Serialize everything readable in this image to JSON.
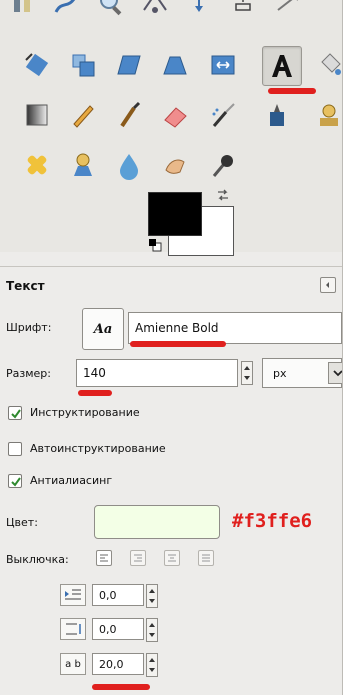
{
  "tool_options": {
    "title": "Текст",
    "font": {
      "label": "Шрифт:",
      "preview": "Aa",
      "value": "Amienne Bold"
    },
    "size": {
      "label": "Размер:",
      "value": "140",
      "unit": "px"
    },
    "hinting": {
      "label": "Инструктирование",
      "checked": true
    },
    "autohint": {
      "label": "Автоинструктирование",
      "checked": false
    },
    "antialias": {
      "label": "Антиалиасинг",
      "checked": true
    },
    "color": {
      "label": "Цвет:",
      "value": "#f3ffe6",
      "annotation": "#f3ffe6"
    },
    "justify": {
      "label": "Выключка:",
      "active_index": 0
    },
    "indent": {
      "value": "0,0"
    },
    "line_spacing": {
      "value": "0,0"
    },
    "letter_spacing": {
      "value": "20,0",
      "icon_text": "a b"
    }
  },
  "colors": {
    "foreground": "#000000",
    "background": "#ffffff",
    "annotation": "#e0201e"
  },
  "toolbox": {
    "active_tool": "text-tool",
    "icons": [
      "smudge-icon",
      "path-icon",
      "zoom-icon",
      "measure-icon",
      "move-icon",
      "align-icon",
      "crop-icon",
      "rotate-icon",
      "scale-icon",
      "shear-icon",
      "perspective-icon",
      "flip-icon",
      "text-icon",
      "bucket-fill-icon",
      "blend-icon",
      "pencil-icon",
      "paintbrush-icon",
      "eraser-icon",
      "airbrush-icon",
      "ink-icon",
      "clone-icon",
      "heal-icon",
      "perspective-clone-icon",
      "blur-icon",
      "smudge-finger-icon",
      "dodge-burn-icon"
    ]
  }
}
